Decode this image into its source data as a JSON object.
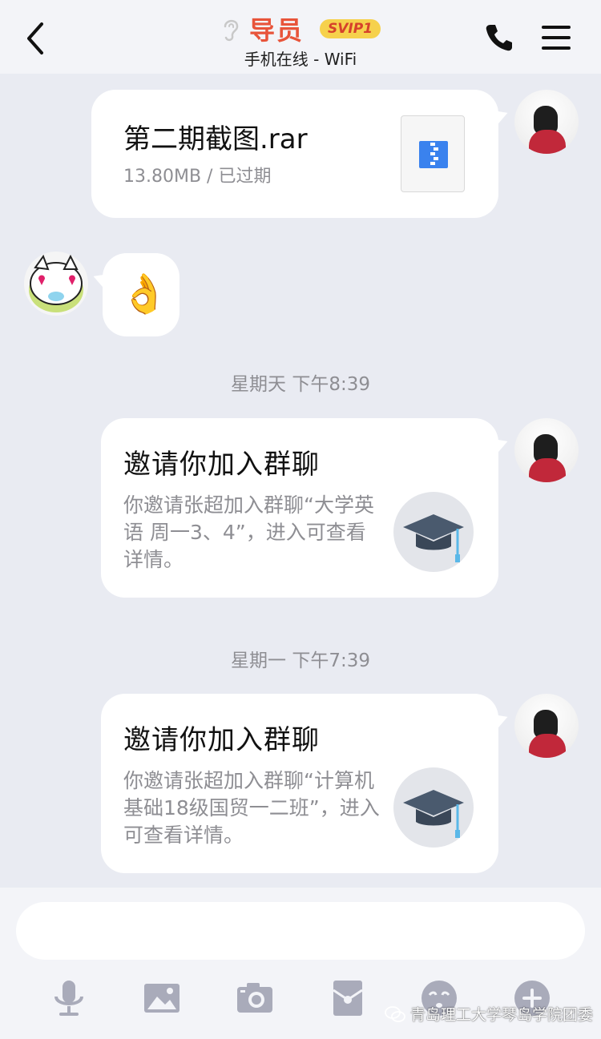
{
  "header": {
    "title": "导员",
    "badge": "SVIP1",
    "status": "手机在线 - WiFi",
    "icons": [
      "back-arrow-icon",
      "ear-icon",
      "phone-icon",
      "menu-icon"
    ]
  },
  "messages": {
    "file": {
      "name": "第二期截图.rar",
      "meta": "13.80MB / 已过期",
      "icon": "zip-file-icon"
    },
    "emoji": {
      "content": "👌"
    },
    "time1": "星期天 下午8:39",
    "invite1": {
      "title": "邀请你加入群聊",
      "desc": "你邀请张超加入群聊“大学英语 周一3、4”，进入可查看详情。",
      "icon": "graduation-cap-icon"
    },
    "time2": "星期一 下午7:39",
    "invite2": {
      "title": "邀请你加入群聊",
      "desc": "你邀请张超加入群聊“计算机基础18级国贸一二班”，进入可查看详情。",
      "icon": "graduation-cap-icon"
    }
  },
  "input": {
    "placeholder": ""
  },
  "toolbar": {
    "icons": [
      "microphone-icon",
      "image-icon",
      "camera-icon",
      "red-packet-icon",
      "emoji-icon",
      "plus-icon"
    ]
  },
  "watermark": {
    "text": "青岛理工大学琴岛学院团委"
  },
  "colors": {
    "background": "#e9ebf2",
    "title": "#e8543a",
    "badge": "#f6d14c",
    "icon_gray": "#a9abba",
    "zip_blue": "#3a82ee"
  }
}
